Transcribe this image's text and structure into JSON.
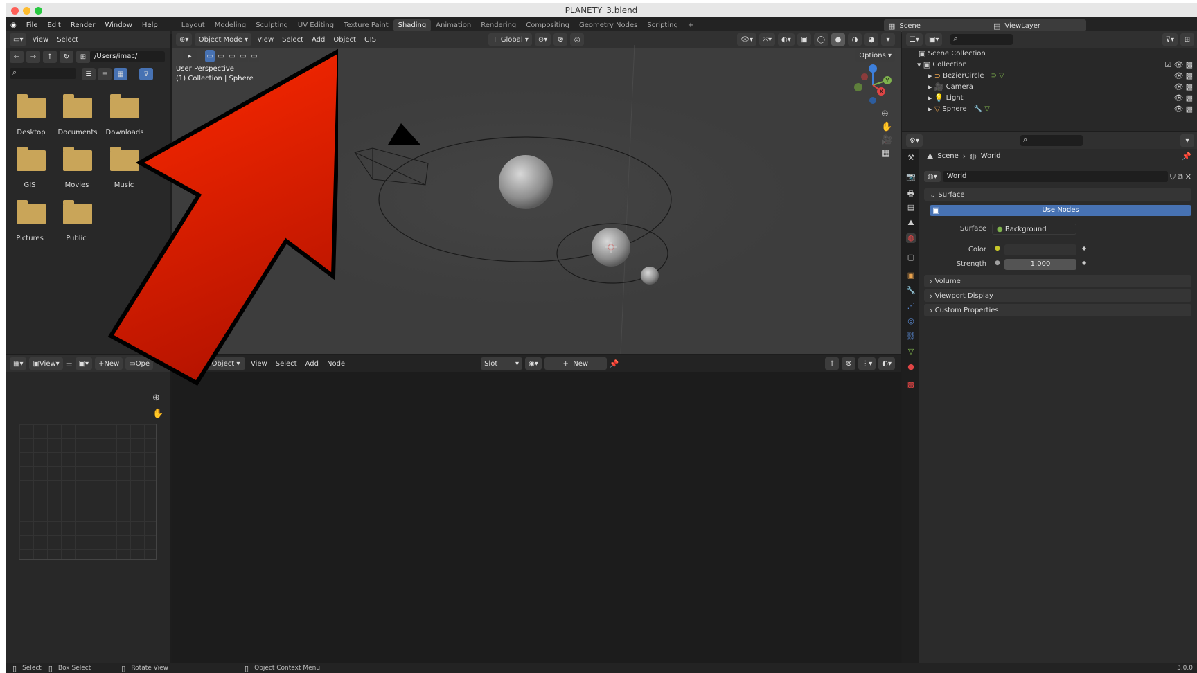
{
  "window": {
    "title": "PLANETY_3.blend"
  },
  "menu": {
    "items": [
      "File",
      "Edit",
      "Render",
      "Window",
      "Help"
    ]
  },
  "workspaces": {
    "tabs": [
      "Layout",
      "Modeling",
      "Sculpting",
      "UV Editing",
      "Texture Paint",
      "Shading",
      "Animation",
      "Rendering",
      "Compositing",
      "Geometry Nodes",
      "Scripting"
    ],
    "active": "Shading",
    "add": "+"
  },
  "scene": {
    "name": "Scene",
    "view_layer": "ViewLayer"
  },
  "file_browser": {
    "header": [
      "View",
      "Select"
    ],
    "path": "/Users/imac/",
    "folders": [
      "Desktop",
      "Documents",
      "Downloads",
      "GIS",
      "Movies",
      "Music",
      "Pictures",
      "Public"
    ]
  },
  "viewport": {
    "mode": "Object Mode",
    "menus": [
      "View",
      "Select",
      "Add",
      "Object",
      "GIS"
    ],
    "transform": "Global",
    "options": "Options",
    "perspective": "User Perspective",
    "collection_info": "(1) Collection | Sphere"
  },
  "image_editor": {
    "view": "View",
    "new": "New",
    "open": "Ope"
  },
  "node_editor": {
    "object": "Object",
    "menus": [
      "View",
      "Select",
      "Add",
      "Node"
    ],
    "slot": "Slot",
    "new": "New"
  },
  "outliner": {
    "root": "Scene Collection",
    "collection": "Collection",
    "items": [
      "BezierCircle",
      "Camera",
      "Light",
      "Sphere"
    ]
  },
  "properties": {
    "breadcrumb_scene": "Scene",
    "breadcrumb_world": "World",
    "world_name": "World",
    "surface_panel": "Surface",
    "use_nodes": "Use Nodes",
    "surface_label": "Surface",
    "surface_value": "Background",
    "color_label": "Color",
    "strength_label": "Strength",
    "strength_value": "1.000",
    "panels": [
      "Volume",
      "Viewport Display",
      "Custom Properties"
    ]
  },
  "statusbar": {
    "select": "Select",
    "box_select": "Box Select",
    "rotate": "Rotate View",
    "context": "Object Context Menu",
    "version": "3.0.0"
  },
  "colors": {
    "accent_blue": "#4772b3",
    "arrow_red": "#ff2200",
    "folder": "#c9a559"
  }
}
